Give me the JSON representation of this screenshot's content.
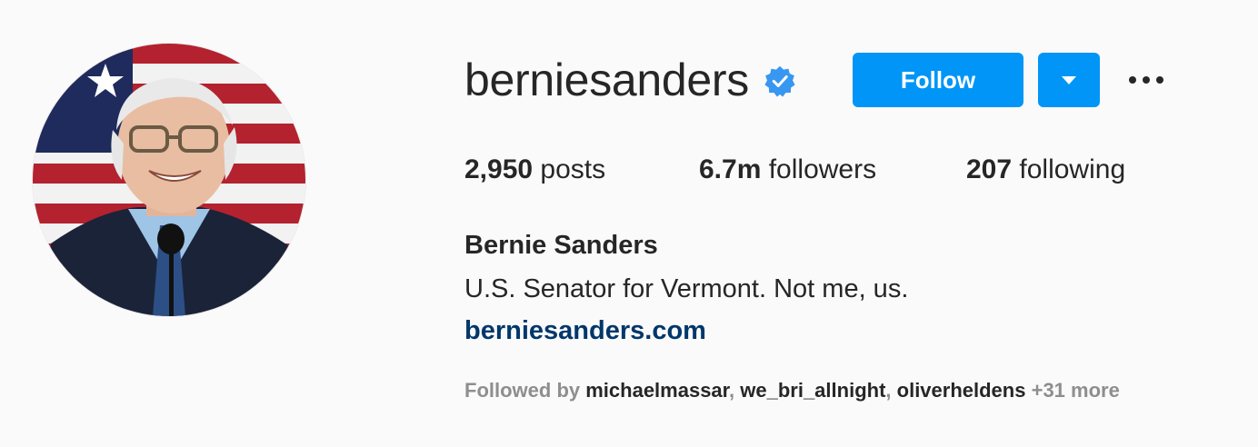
{
  "profile": {
    "username": "berniesanders",
    "verified_icon": "verified-badge-icon",
    "full_name": "Bernie Sanders",
    "bio": "U.S. Senator for Vermont. Not me, us.",
    "website": "berniesanders.com"
  },
  "actions": {
    "follow_label": "Follow",
    "dropdown_icon": "chevron-down-icon",
    "more_icon": "more-options-icon"
  },
  "stats": {
    "posts_count": "2,950",
    "posts_label": " posts",
    "followers_count": "6.7m",
    "followers_label": " followers",
    "following_count": "207",
    "following_label": " following"
  },
  "followed_by": {
    "prefix": "Followed by ",
    "users": [
      "michaelmassar",
      "we_bri_allnight",
      "oliverheldens"
    ],
    "separator": ", ",
    "more": " +31 more"
  },
  "colors": {
    "accent": "#0095f6",
    "link": "#00376b",
    "text": "#262626",
    "muted": "#8e8e8e",
    "background": "#fafafa"
  }
}
